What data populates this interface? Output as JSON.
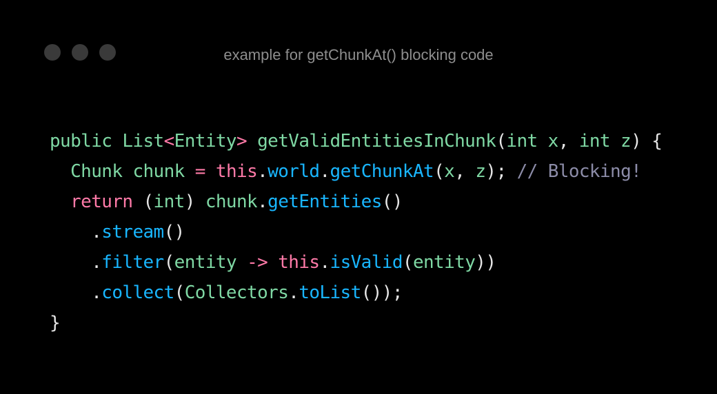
{
  "window": {
    "title": "example for getChunkAt() blocking code",
    "controls": [
      "close",
      "minimize",
      "maximize"
    ]
  },
  "colors": {
    "background": "#000000",
    "control_dot": "#3a3a3a",
    "title": "#8e8e8e",
    "plain": "#e6e6e6",
    "type": "#7fd8a4",
    "keyword": "#ff7aa8",
    "function": "#19b6ff",
    "comment": "#8c8ca8"
  },
  "code": {
    "lines": [
      [
        {
          "t": "public ",
          "c": "type"
        },
        {
          "t": "List",
          "c": "type"
        },
        {
          "t": "<",
          "c": "keyword"
        },
        {
          "t": "Entity",
          "c": "type"
        },
        {
          "t": ">",
          "c": "keyword"
        },
        {
          "t": " ",
          "c": "plain"
        },
        {
          "t": "getValidEntitiesInChunk",
          "c": "type"
        },
        {
          "t": "(",
          "c": "plain"
        },
        {
          "t": "int",
          "c": "type"
        },
        {
          "t": " ",
          "c": "plain"
        },
        {
          "t": "x",
          "c": "type"
        },
        {
          "t": ", ",
          "c": "plain"
        },
        {
          "t": "int",
          "c": "type"
        },
        {
          "t": " ",
          "c": "plain"
        },
        {
          "t": "z",
          "c": "type"
        },
        {
          "t": ") {",
          "c": "plain"
        }
      ],
      [
        {
          "t": "  ",
          "c": "plain"
        },
        {
          "t": "Chunk",
          "c": "type"
        },
        {
          "t": " ",
          "c": "plain"
        },
        {
          "t": "chunk",
          "c": "type"
        },
        {
          "t": " ",
          "c": "plain"
        },
        {
          "t": "=",
          "c": "keyword"
        },
        {
          "t": " ",
          "c": "plain"
        },
        {
          "t": "this",
          "c": "keyword"
        },
        {
          "t": ".",
          "c": "plain"
        },
        {
          "t": "world",
          "c": "function"
        },
        {
          "t": ".",
          "c": "plain"
        },
        {
          "t": "getChunkAt",
          "c": "function"
        },
        {
          "t": "(",
          "c": "plain"
        },
        {
          "t": "x",
          "c": "type"
        },
        {
          "t": ", ",
          "c": "plain"
        },
        {
          "t": "z",
          "c": "type"
        },
        {
          "t": "); ",
          "c": "plain"
        },
        {
          "t": "// Blocking!",
          "c": "comment"
        }
      ],
      [
        {
          "t": "  ",
          "c": "plain"
        },
        {
          "t": "return",
          "c": "keyword"
        },
        {
          "t": " (",
          "c": "plain"
        },
        {
          "t": "int",
          "c": "type"
        },
        {
          "t": ") ",
          "c": "plain"
        },
        {
          "t": "chunk",
          "c": "type"
        },
        {
          "t": ".",
          "c": "plain"
        },
        {
          "t": "getEntities",
          "c": "function"
        },
        {
          "t": "()",
          "c": "plain"
        }
      ],
      [
        {
          "t": "    .",
          "c": "plain"
        },
        {
          "t": "stream",
          "c": "function"
        },
        {
          "t": "()",
          "c": "plain"
        }
      ],
      [
        {
          "t": "    .",
          "c": "plain"
        },
        {
          "t": "filter",
          "c": "function"
        },
        {
          "t": "(",
          "c": "plain"
        },
        {
          "t": "entity",
          "c": "type"
        },
        {
          "t": " ",
          "c": "plain"
        },
        {
          "t": "->",
          "c": "keyword"
        },
        {
          "t": " ",
          "c": "plain"
        },
        {
          "t": "this",
          "c": "keyword"
        },
        {
          "t": ".",
          "c": "plain"
        },
        {
          "t": "isValid",
          "c": "function"
        },
        {
          "t": "(",
          "c": "plain"
        },
        {
          "t": "entity",
          "c": "type"
        },
        {
          "t": "))",
          "c": "plain"
        }
      ],
      [
        {
          "t": "    .",
          "c": "plain"
        },
        {
          "t": "collect",
          "c": "function"
        },
        {
          "t": "(",
          "c": "plain"
        },
        {
          "t": "Collectors",
          "c": "type"
        },
        {
          "t": ".",
          "c": "plain"
        },
        {
          "t": "toList",
          "c": "function"
        },
        {
          "t": "());",
          "c": "plain"
        }
      ],
      [
        {
          "t": "}",
          "c": "plain"
        }
      ]
    ]
  }
}
